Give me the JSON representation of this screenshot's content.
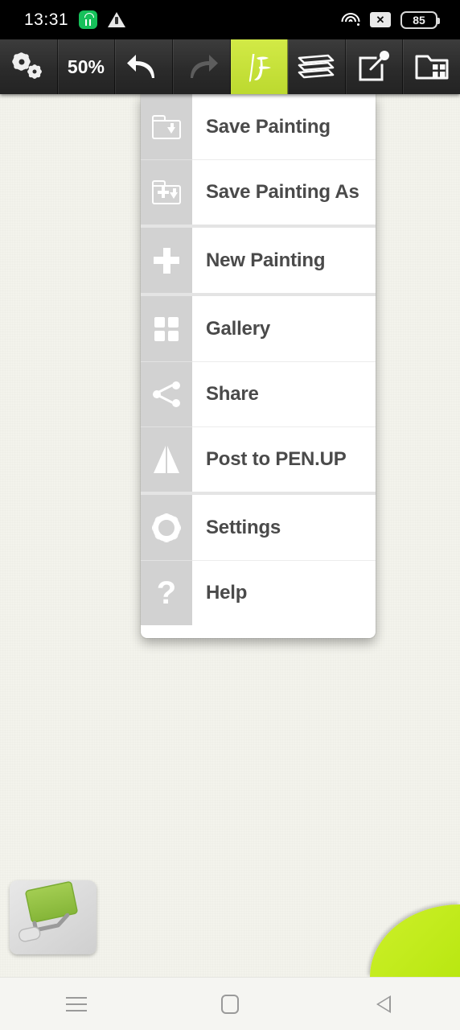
{
  "status_bar": {
    "time": "13:31",
    "battery_level": "85",
    "icons": [
      "store-icon",
      "warning-icon",
      "wifi-icon",
      "no-sim-icon",
      "battery-icon"
    ]
  },
  "toolbar": {
    "settings_label": "settings-gears-icon",
    "zoom_level": "50%",
    "undo_label": "undo-icon",
    "redo_label": "redo-icon",
    "brush_label": "brush-icon",
    "layers_label": "layers-icon",
    "export_label": "export-icon",
    "menu_label": "folder-menu-icon",
    "active_accent": "#c8e33c"
  },
  "menu": {
    "groups": [
      {
        "items": [
          {
            "label": "Save Painting",
            "icon": "folder-save-icon"
          },
          {
            "label": "Save Painting As",
            "icon": "folder-save-as-icon"
          }
        ]
      },
      {
        "items": [
          {
            "label": "New Painting",
            "icon": "plus-icon"
          }
        ]
      },
      {
        "items": [
          {
            "label": "Gallery",
            "icon": "grid-icon"
          },
          {
            "label": "Share",
            "icon": "share-icon"
          },
          {
            "label": "Post to PEN.UP",
            "icon": "penup-icon"
          }
        ]
      },
      {
        "items": [
          {
            "label": "Settings",
            "icon": "gear-icon"
          },
          {
            "label": "Help",
            "icon": "question-mark-icon"
          }
        ]
      }
    ]
  },
  "tools": {
    "fill_tool": "paint-roller-icon",
    "color_swatch": "#c6ee1d"
  },
  "nav_bar": {
    "recent_label": "recent-apps-icon",
    "home_label": "home-icon",
    "back_label": "back-icon"
  }
}
